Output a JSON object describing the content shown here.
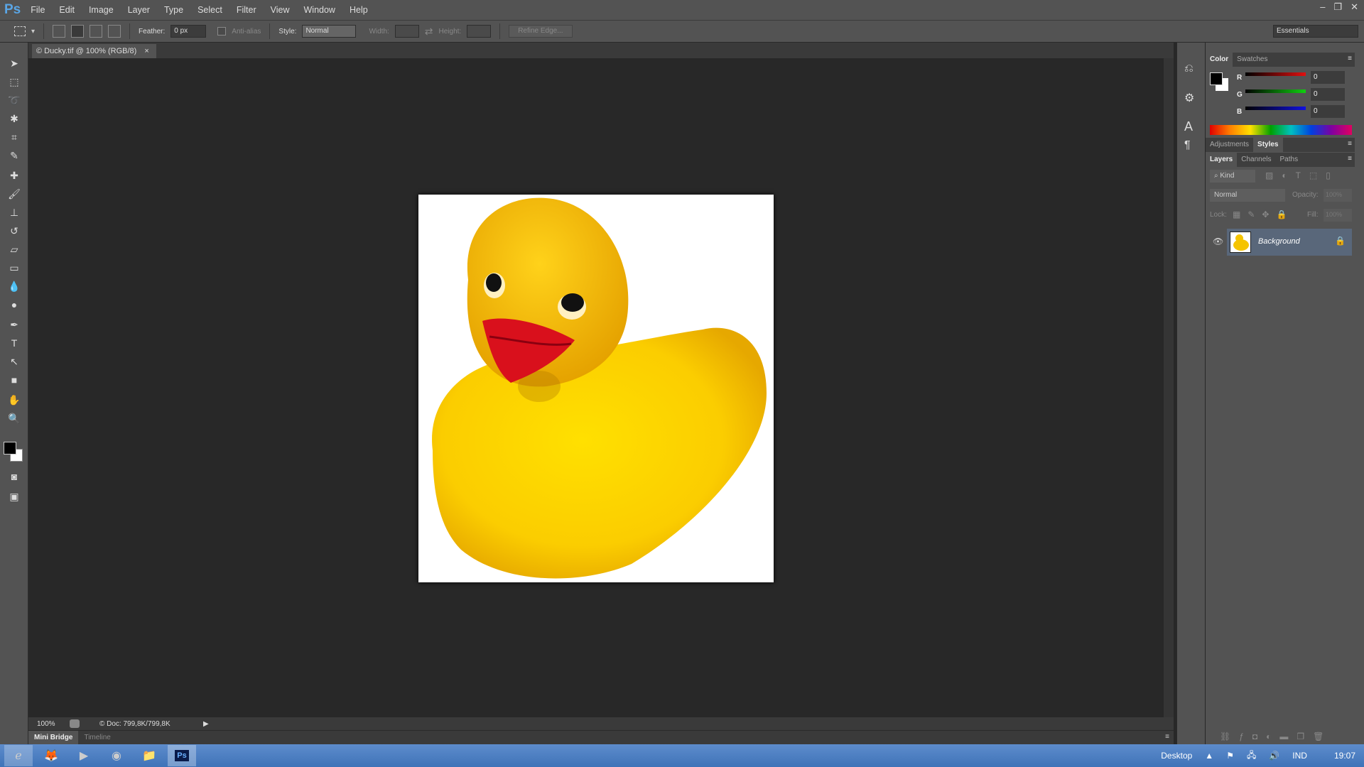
{
  "app": {
    "logo": "Ps",
    "menu": [
      "File",
      "Edit",
      "Image",
      "Layer",
      "Type",
      "Select",
      "Filter",
      "View",
      "Window",
      "Help"
    ]
  },
  "options": {
    "feather_label": "Feather:",
    "feather_value": "0 px",
    "antialias_label": "Anti-alias",
    "style_label": "Style:",
    "style_value": "Normal",
    "width_label": "Width:",
    "height_label": "Height:",
    "refine_edge": "Refine Edge...",
    "workspace": "Essentials"
  },
  "document": {
    "tab": "© Ducky.tif @ 100% (RGB/8)",
    "zoom": "100%",
    "doc_size": "© Doc: 799,8K/799,8K"
  },
  "bottom_tabs": [
    "Mini Bridge",
    "Timeline"
  ],
  "color_panel": {
    "tabs": [
      "Color",
      "Swatches"
    ],
    "channels": [
      {
        "label": "R",
        "value": "0",
        "color": "#e01010"
      },
      {
        "label": "G",
        "value": "0",
        "color": "#10d010"
      },
      {
        "label": "B",
        "value": "0",
        "color": "#1010e0"
      }
    ],
    "foreground": "#000000",
    "background": "#ffffff"
  },
  "adjust_tabs": [
    "Adjustments",
    "Styles"
  ],
  "layers_panel": {
    "tabs": [
      "Layers",
      "Channels",
      "Paths"
    ],
    "filter": "Kind",
    "blend_mode": "Normal",
    "opacity_label": "Opacity:",
    "opacity": "100%",
    "lock_label": "Lock:",
    "fill_label": "Fill:",
    "fill": "100%",
    "layers": [
      {
        "name": "Background",
        "visible": true,
        "locked": true
      }
    ]
  },
  "taskbar": {
    "apps": [
      "internet-explorer",
      "firefox",
      "media-player",
      "chrome",
      "file-explorer",
      "photoshop"
    ],
    "desktop": "Desktop",
    "language": "IND",
    "time": "19:07"
  }
}
